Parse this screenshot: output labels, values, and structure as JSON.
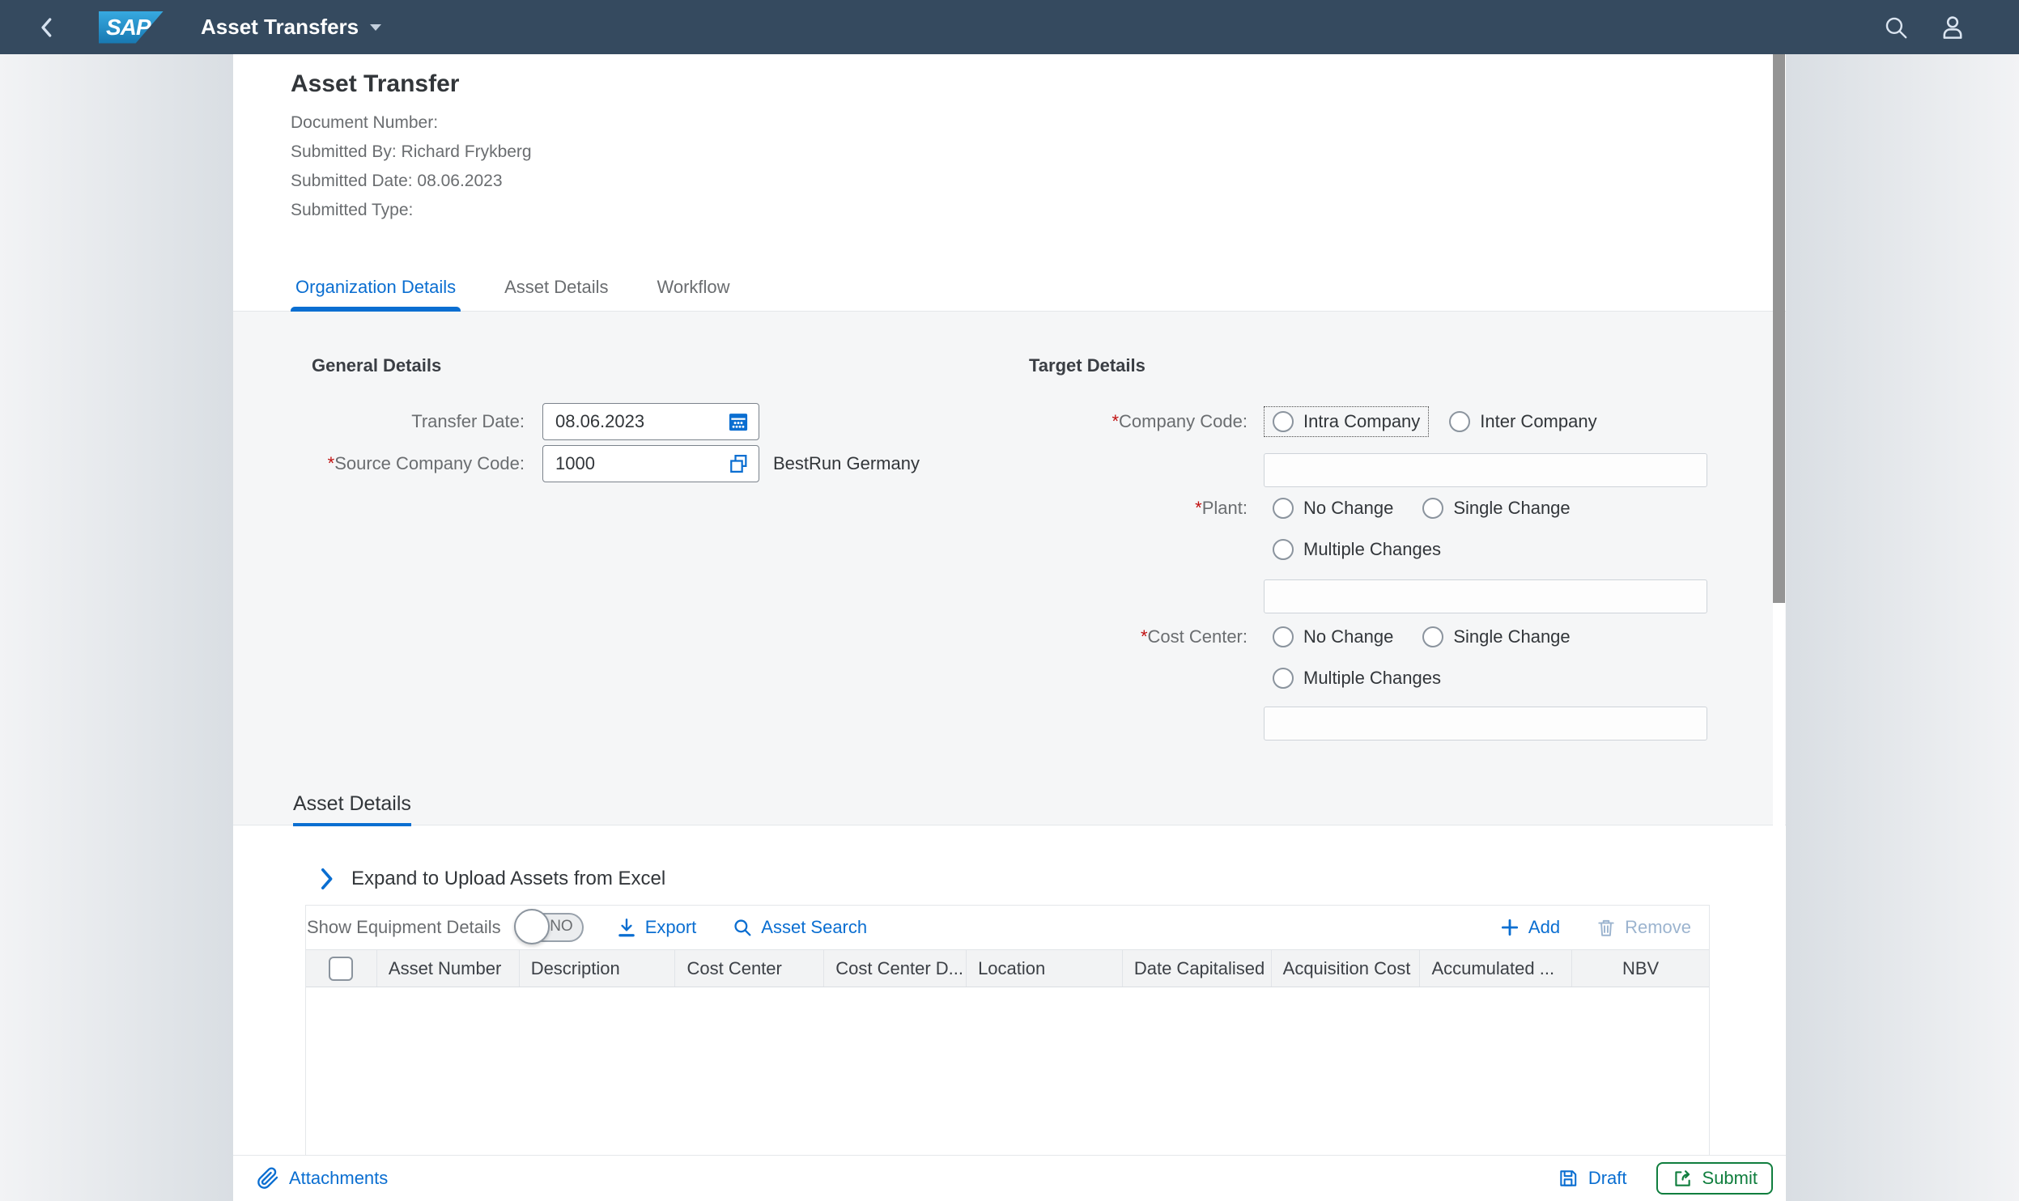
{
  "shell": {
    "logo": "SAP",
    "title": "Asset Transfers"
  },
  "page": {
    "title": "Asset Transfer",
    "info": [
      "Document Number:",
      "Submitted By: Richard Frykberg",
      "Submitted Date: 08.06.2023",
      "Submitted Type:"
    ]
  },
  "tabs": [
    {
      "label": "Organization Details"
    },
    {
      "label": "Asset Details"
    },
    {
      "label": "Workflow"
    }
  ],
  "required_mark": "*",
  "general": {
    "heading": "General Details",
    "transfer_date": {
      "label": "Transfer Date:",
      "value": "08.06.2023"
    },
    "source_company_code": {
      "label": "Source Company Code:",
      "value": "1000",
      "helper": "BestRun Germany"
    }
  },
  "target": {
    "heading": "Target Details",
    "company_code": {
      "label": "Company Code:",
      "options": [
        "Intra Company",
        "Inter Company"
      ]
    },
    "plant": {
      "label": "Plant:",
      "options": [
        "No Change",
        "Single Change",
        "Multiple Changes"
      ]
    },
    "cost_center": {
      "label": "Cost Center:",
      "options": [
        "No Change",
        "Single Change",
        "Multiple Changes"
      ]
    }
  },
  "asset_section": {
    "heading": "Asset Details",
    "expand_label": "Expand to Upload Assets from Excel",
    "toolbar": {
      "show_equipment": "Show Equipment Details",
      "toggle_state": "NO",
      "export": "Export",
      "asset_search": "Asset Search",
      "add": "Add",
      "remove": "Remove"
    },
    "table": {
      "columns": [
        "Asset Number",
        "Description",
        "Cost Center",
        "Cost Center D...",
        "Location",
        "Date Capitalised",
        "Acquisition Cost",
        "Accumulated ...",
        "NBV"
      ],
      "rows": []
    }
  },
  "footer": {
    "attachments": "Attachments",
    "draft": "Draft",
    "submit": "Submit"
  },
  "colors": {
    "shell_bg": "#354a5f",
    "accent": "#0a6ed1",
    "positive": "#107e3e",
    "required": "#c00f0f"
  }
}
